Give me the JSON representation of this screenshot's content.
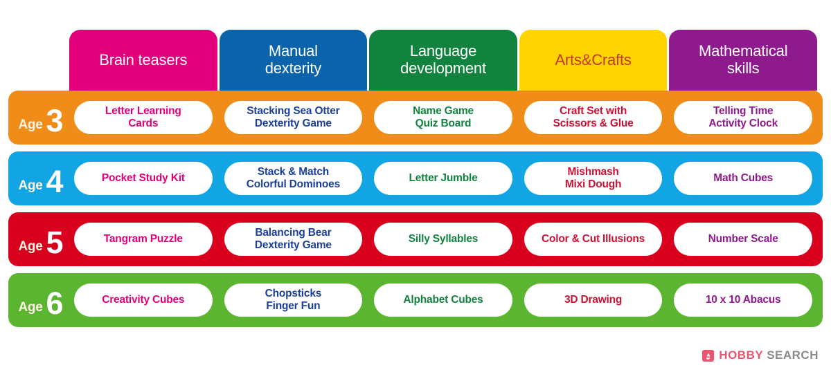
{
  "palette": {
    "magenta": "#e2007a",
    "blue": "#0b63ac",
    "green": "#12833f",
    "yellow": "#ffd400",
    "purple": "#8e1a8e",
    "orange": "#f08c18",
    "cyan": "#12a5e3",
    "red": "#d8001c",
    "lightgreen": "#5cb531",
    "text_magenta": "#e2007a",
    "text_blue": "#1b3f9c",
    "text_green": "#12833f",
    "text_red": "#cc1133",
    "text_purple": "#8e1a8e",
    "text_arts_header": "#c0392b",
    "white": "#ffffff",
    "age_word": "#fdf3e3"
  },
  "columns": [
    {
      "label": "Brain teasers",
      "bg": "#e2007a",
      "fg": "#ffffff"
    },
    {
      "label": "Manual\ndexterity",
      "bg": "#0b63ac",
      "fg": "#ffffff"
    },
    {
      "label": "Language\ndevelopment",
      "bg": "#12833f",
      "fg": "#ffffff"
    },
    {
      "label": "Arts&Crafts",
      "bg": "#ffd400",
      "fg": "#c0392b"
    },
    {
      "label": "Mathematical\nskills",
      "bg": "#8e1a8e",
      "fg": "#ffffff"
    }
  ],
  "rows": [
    {
      "age_word": "Age",
      "age_number": "3",
      "bg": "#f08c18",
      "cells": [
        {
          "label": "Letter Learning\nCards",
          "fg": "#e2007a"
        },
        {
          "label": "Stacking Sea Otter\nDexterity Game",
          "fg": "#1b3f9c"
        },
        {
          "label": "Name Game\nQuiz Board",
          "fg": "#12833f"
        },
        {
          "label": "Craft Set with\nScissors & Glue",
          "fg": "#cc1133"
        },
        {
          "label": "Telling Time\nActivity Clock",
          "fg": "#8e1a8e"
        }
      ]
    },
    {
      "age_word": "Age",
      "age_number": "4",
      "bg": "#12a5e3",
      "cells": [
        {
          "label": "Pocket Study Kit",
          "fg": "#e2007a"
        },
        {
          "label": "Stack & Match\nColorful Dominoes",
          "fg": "#1b3f9c"
        },
        {
          "label": "Letter Jumble",
          "fg": "#12833f"
        },
        {
          "label": "Mishmash\nMixi Dough",
          "fg": "#cc1133"
        },
        {
          "label": "Math Cubes",
          "fg": "#8e1a8e"
        }
      ]
    },
    {
      "age_word": "Age",
      "age_number": "5",
      "bg": "#d8001c",
      "cells": [
        {
          "label": "Tangram Puzzle",
          "fg": "#e2007a"
        },
        {
          "label": "Balancing Bear\nDexterity Game",
          "fg": "#1b3f9c"
        },
        {
          "label": "Silly Syllables",
          "fg": "#12833f"
        },
        {
          "label": "Color & Cut Illusions",
          "fg": "#cc1133"
        },
        {
          "label": "Number Scale",
          "fg": "#8e1a8e"
        }
      ]
    },
    {
      "age_word": "Age",
      "age_number": "6",
      "bg": "#5cb531",
      "cells": [
        {
          "label": "Creativity Cubes",
          "fg": "#e2007a"
        },
        {
          "label": "Chopsticks\nFinger Fun",
          "fg": "#1b3f9c"
        },
        {
          "label": "Alphabet Cubes",
          "fg": "#12833f"
        },
        {
          "label": "3D Drawing",
          "fg": "#cc1133"
        },
        {
          "label": "10 x 10 Abacus",
          "fg": "#8e1a8e"
        }
      ]
    }
  ],
  "logo": {
    "mark": "flame-icon",
    "primary": "HOBBY",
    "secondary": "SEARCH"
  }
}
